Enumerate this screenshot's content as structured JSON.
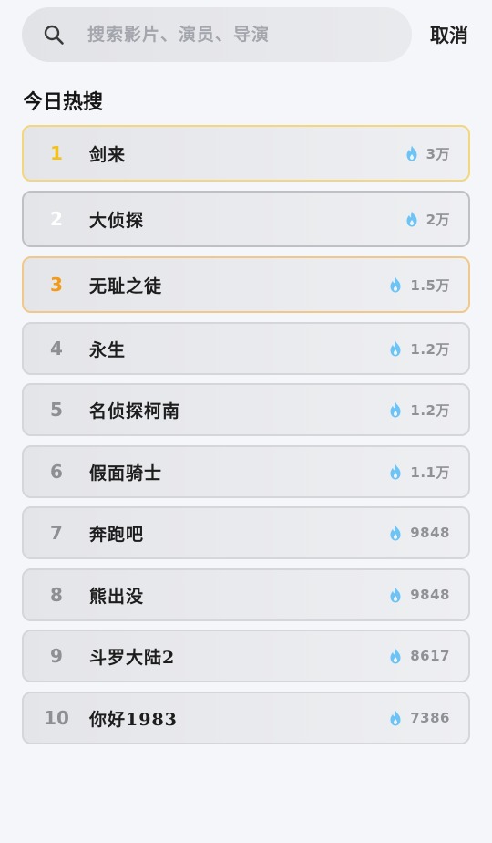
{
  "search": {
    "placeholder": "搜索影片、演员、导演",
    "cancel_label": "取消"
  },
  "hot": {
    "section_title": "今日热搜",
    "items": [
      {
        "rank": "1",
        "title": "剑来",
        "heat": "3万"
      },
      {
        "rank": "2",
        "title": "大侦探",
        "heat": "2万"
      },
      {
        "rank": "3",
        "title": "无耻之徒",
        "heat": "1.5万"
      },
      {
        "rank": "4",
        "title": "永生",
        "heat": "1.2万"
      },
      {
        "rank": "5",
        "title": "名侦探柯南",
        "heat": "1.2万"
      },
      {
        "rank": "6",
        "title": "假面骑士",
        "heat": "1.1万"
      },
      {
        "rank": "7",
        "title": "奔跑吧",
        "heat": "9848"
      },
      {
        "rank": "8",
        "title": "熊出没",
        "heat": "9848"
      },
      {
        "rank": "9",
        "title": "斗罗大陆2",
        "heat": "8617"
      },
      {
        "rank": "10",
        "title": "你好1983",
        "heat": "7386"
      }
    ]
  },
  "icons": {
    "search": "search-icon",
    "heat": "flame-icon"
  },
  "colors": {
    "rank1": "#f2c21a",
    "rank2": "#ffffff",
    "rank3": "#f39a17",
    "flame": "#6ec3f5",
    "background": "#f5f6fa"
  }
}
